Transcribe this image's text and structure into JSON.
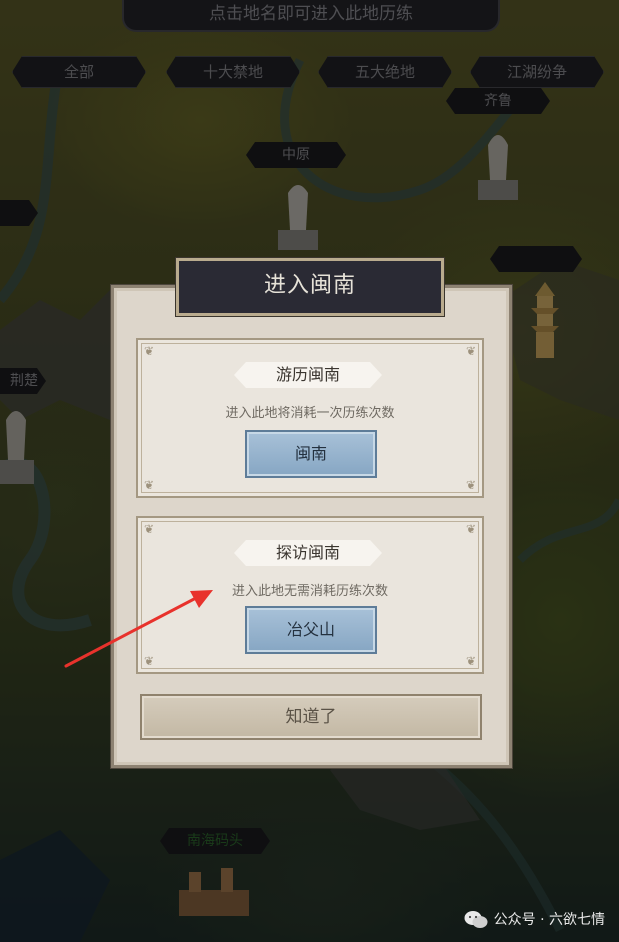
{
  "header": {
    "hint": "点击地名即可进入此地历练"
  },
  "filter_tabs": [
    {
      "label": "全部"
    },
    {
      "label": "十大禁地"
    },
    {
      "label": "五大绝地"
    },
    {
      "label": "江湖纷争"
    }
  ],
  "map_places": {
    "qilu": "齐鲁",
    "zhongyuan": "中原",
    "jingchu": "荆楚",
    "nanhai_matou": "南海码头"
  },
  "dialog": {
    "title": "进入闽南",
    "panel_travel": {
      "header": "游历闽南",
      "note": "进入此地将消耗一次历练次数",
      "button": "闽南"
    },
    "panel_visit": {
      "header": "探访闽南",
      "note": "进入此地无需消耗历练次数",
      "button": "冶父山"
    },
    "ok_button": "知道了"
  },
  "watermark": {
    "text": "公众号 · 六欲七情"
  },
  "colors": {
    "annotation_arrow": "#e8322c",
    "button_blue": "#8fadc9",
    "dialog_bg": "#ddd6cb"
  }
}
